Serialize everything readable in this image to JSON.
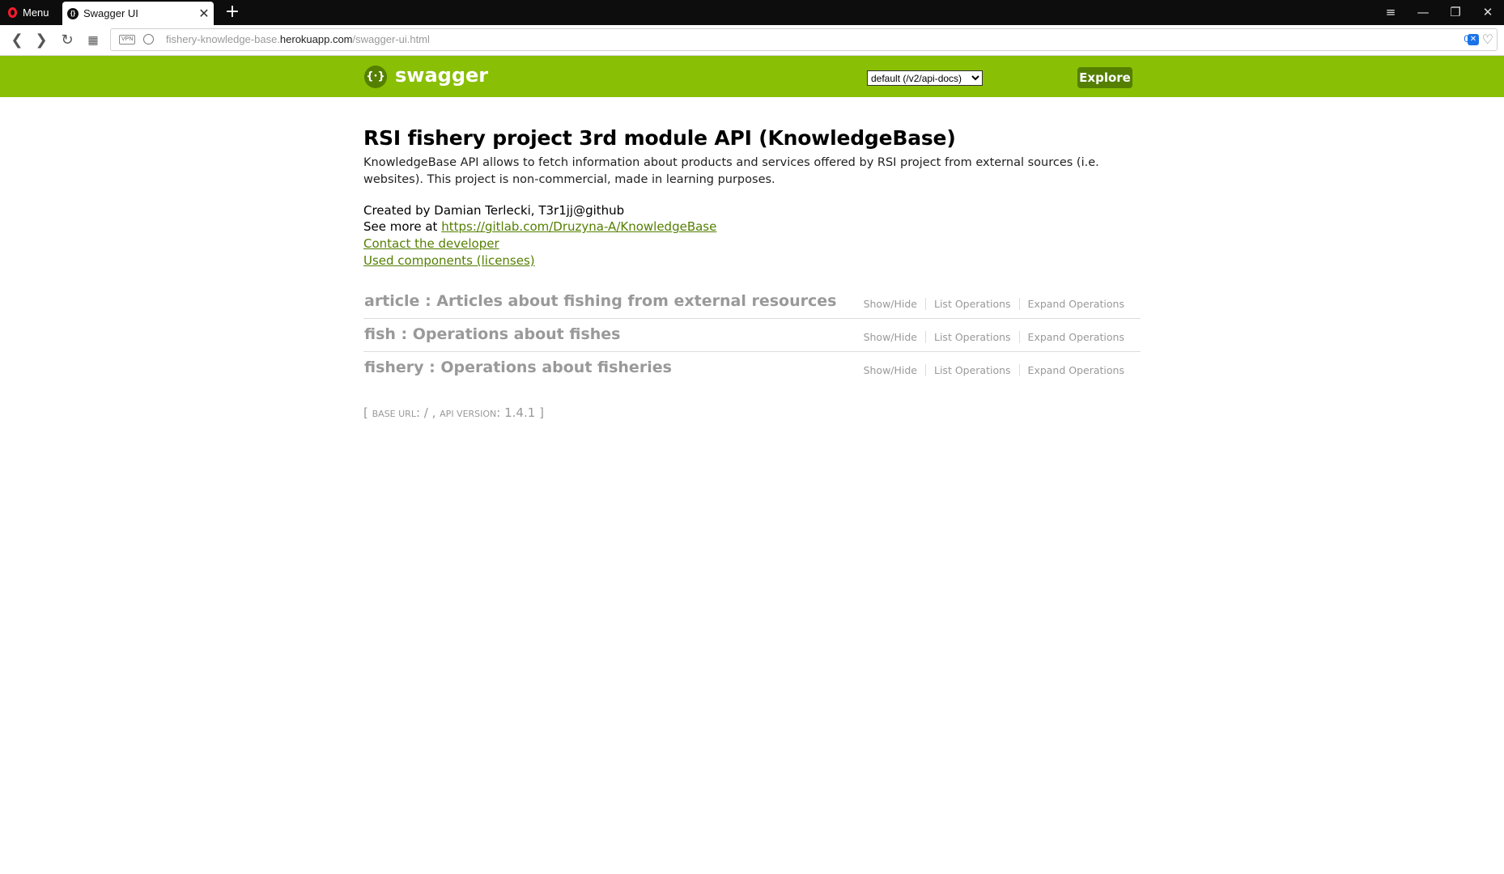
{
  "browser": {
    "menu_label": "Menu",
    "tab_title": "Swagger UI",
    "url_prefix": "fishery-knowledge-base.",
    "url_domain": "herokuapp.com",
    "url_path": "/swagger-ui.html",
    "vpn_label": "VPN",
    "blocked_count": "0"
  },
  "swagger": {
    "brand": "swagger",
    "spec_selected": "default (/v2/api-docs)",
    "explore_label": "Explore"
  },
  "info": {
    "title": "RSI fishery project 3rd module API (KnowledgeBase)",
    "description": "KnowledgeBase API allows to fetch information about products and services offered by RSI project from external sources (i.e. websites). This project is non-commercial, made in learning purposes.",
    "created_by": "Created by Damian Terlecki, T3r1jj@github",
    "see_more_prefix": "See more at ",
    "see_more_link": "https://gitlab.com/Druzyna-A/KnowledgeBase",
    "contact_link": "Contact the developer",
    "licenses_link": "Used components (licenses)"
  },
  "resources": [
    {
      "title": "article : Articles about fishing from external resources",
      "show_hide": "Show/Hide",
      "list_ops": "List Operations",
      "expand_ops": "Expand Operations"
    },
    {
      "title": "fish : Operations about fishes",
      "show_hide": "Show/Hide",
      "list_ops": "List Operations",
      "expand_ops": "Expand Operations"
    },
    {
      "title": "fishery : Operations about fisheries",
      "show_hide": "Show/Hide",
      "list_ops": "List Operations",
      "expand_ops": "Expand Operations"
    }
  ],
  "footer": {
    "base_url_label": "base url",
    "base_url_value": "/",
    "api_version_label": "api version",
    "api_version_value": "1.4.1"
  }
}
